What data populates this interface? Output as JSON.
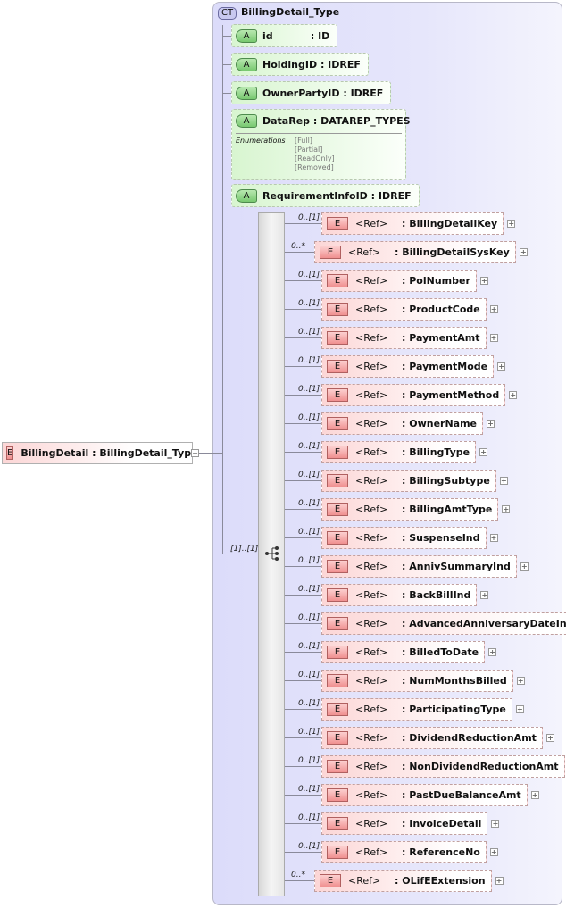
{
  "root": {
    "badge": "E",
    "name": "BillingDetail",
    "type": ": BillingDetail_Type"
  },
  "complex_type": {
    "badge": "CT",
    "name": "BillingDetail_Type"
  },
  "attributes": [
    {
      "badge": "A",
      "name": "id",
      "type": ": ID"
    },
    {
      "badge": "A",
      "name": "HoldingID",
      "type": ": IDREF"
    },
    {
      "badge": "A",
      "name": "OwnerPartyID",
      "type": ": IDREF"
    },
    {
      "badge": "A",
      "name": "DataRep",
      "type": ": DATAREP_TYPES"
    },
    {
      "badge": "A",
      "name": "RequirementInfoID",
      "type": ": IDREF"
    }
  ],
  "enumerations": {
    "label": "Enumerations",
    "values": [
      "[Full]",
      "[Partial]",
      "[ReadOnly]",
      "[Removed]"
    ]
  },
  "sequence": {
    "cardinality": "[1]..[1]"
  },
  "elements": [
    {
      "card": "0..[1]",
      "ref": "<Ref>",
      "name": ": BillingDetailKey"
    },
    {
      "card": "0..*",
      "ref": "<Ref>",
      "name": ": BillingDetailSysKey"
    },
    {
      "card": "0..[1]",
      "ref": "<Ref>",
      "name": ": PolNumber"
    },
    {
      "card": "0..[1]",
      "ref": "<Ref>",
      "name": ": ProductCode"
    },
    {
      "card": "0..[1]",
      "ref": "<Ref>",
      "name": ": PaymentAmt"
    },
    {
      "card": "0..[1]",
      "ref": "<Ref>",
      "name": ": PaymentMode"
    },
    {
      "card": "0..[1]",
      "ref": "<Ref>",
      "name": ": PaymentMethod"
    },
    {
      "card": "0..[1]",
      "ref": "<Ref>",
      "name": ": OwnerName"
    },
    {
      "card": "0..[1]",
      "ref": "<Ref>",
      "name": ": BillingType"
    },
    {
      "card": "0..[1]",
      "ref": "<Ref>",
      "name": ": BillingSubtype"
    },
    {
      "card": "0..[1]",
      "ref": "<Ref>",
      "name": ": BillingAmtType"
    },
    {
      "card": "0..[1]",
      "ref": "<Ref>",
      "name": ": SuspenseInd"
    },
    {
      "card": "0..[1]",
      "ref": "<Ref>",
      "name": ": AnnivSummaryInd"
    },
    {
      "card": "0..[1]",
      "ref": "<Ref>",
      "name": ": BackBillInd"
    },
    {
      "card": "0..[1]",
      "ref": "<Ref>",
      "name": ": AdvancedAnniversaryDateInd"
    },
    {
      "card": "0..[1]",
      "ref": "<Ref>",
      "name": ": BilledToDate"
    },
    {
      "card": "0..[1]",
      "ref": "<Ref>",
      "name": ": NumMonthsBilled"
    },
    {
      "card": "0..[1]",
      "ref": "<Ref>",
      "name": ": ParticipatingType"
    },
    {
      "card": "0..[1]",
      "ref": "<Ref>",
      "name": ": DividendReductionAmt"
    },
    {
      "card": "0..[1]",
      "ref": "<Ref>",
      "name": ": NonDividendReductionAmt"
    },
    {
      "card": "0..[1]",
      "ref": "<Ref>",
      "name": ": PastDueBalanceAmt"
    },
    {
      "card": "0..[1]",
      "ref": "<Ref>",
      "name": ": InvoiceDetail"
    },
    {
      "card": "0..[1]",
      "ref": "<Ref>",
      "name": ": ReferenceNo"
    },
    {
      "card": "0..*",
      "ref": "<Ref>",
      "name": ": OLifEExtension"
    }
  ]
}
